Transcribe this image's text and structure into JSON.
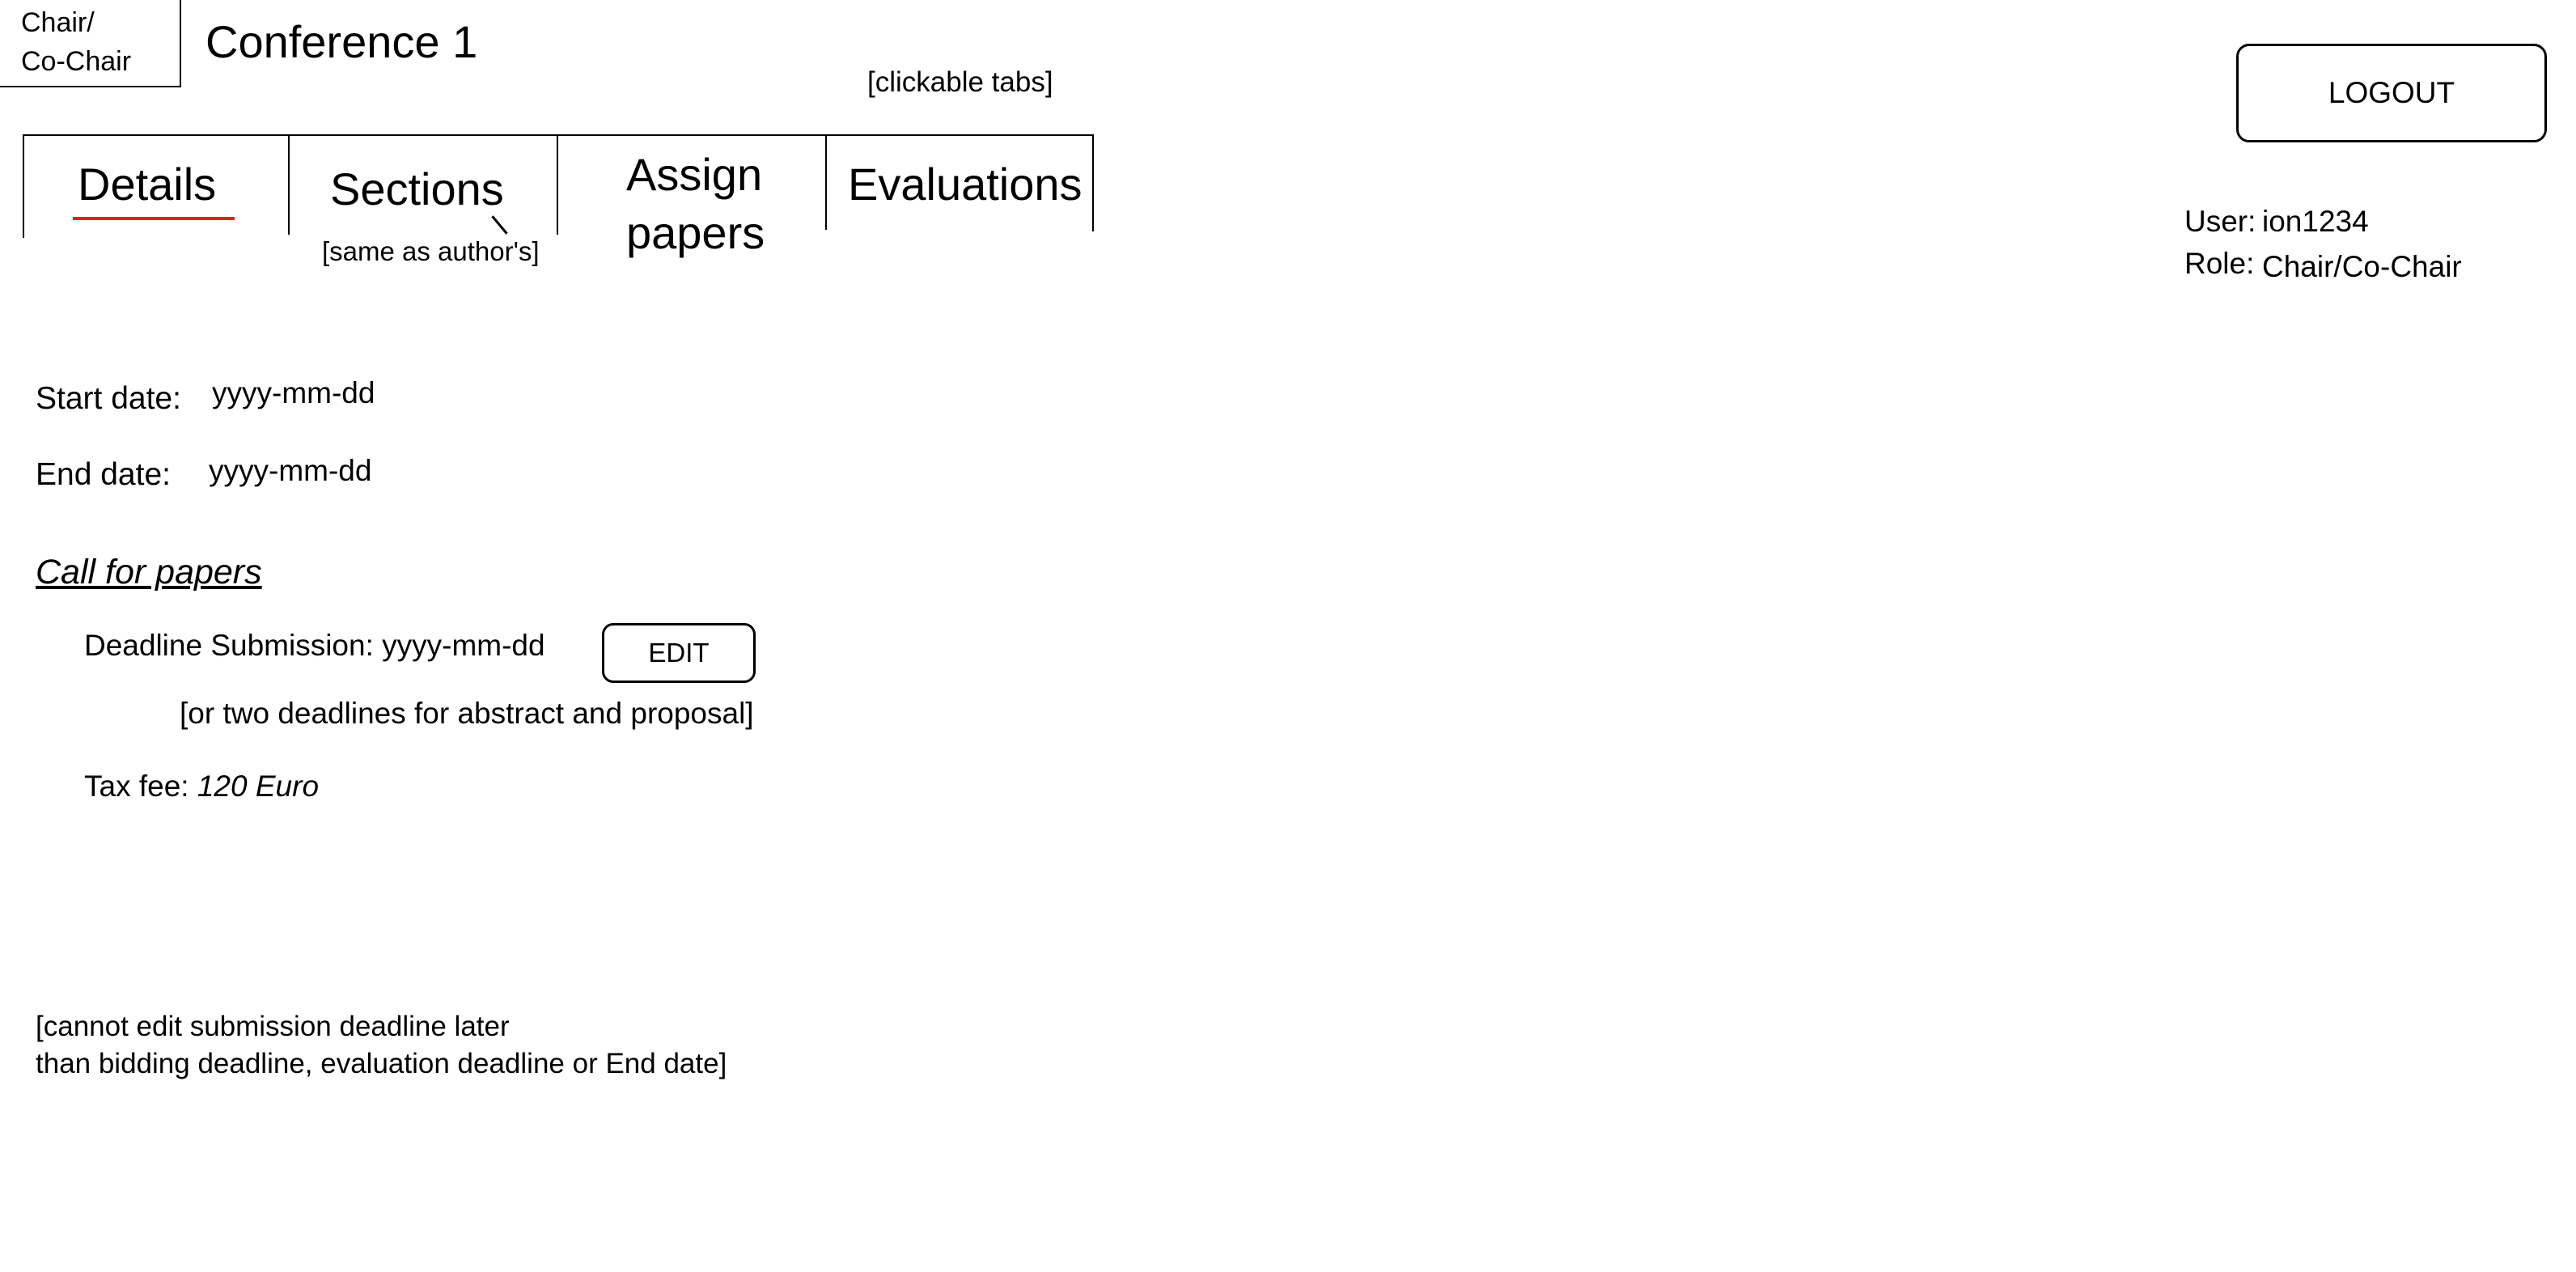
{
  "role_box": {
    "line1": "Chair/",
    "line2": "Co-Chair"
  },
  "conference": {
    "title": "Conference 1"
  },
  "annotations": {
    "tabs_note": "[clickable tabs]",
    "sections_note": "[same as author's]",
    "deadlines_note": "[or two deadlines for abstract and proposal]",
    "bottom_note_line1": "[cannot edit submission deadline later",
    "bottom_note_line2": "than bidding deadline, evaluation deadline or End date]"
  },
  "tabs": [
    {
      "label": "Details",
      "active": true
    },
    {
      "label": "Sections",
      "active": false
    },
    {
      "label_line1": "Assign",
      "label_line2": "papers",
      "active": false
    },
    {
      "label": "Evaluations",
      "active": false
    }
  ],
  "header": {
    "logout_label": "LOGOUT",
    "user_label": "User:",
    "user_value": "ion1234",
    "role_label": "Role:",
    "role_value": "Chair/Co-Chair"
  },
  "details": {
    "start_label": "Start date:",
    "start_value": "yyyy-mm-dd",
    "end_label": "End date:",
    "end_value": "yyyy-mm-dd",
    "cfp_heading": "Call for papers",
    "deadline_label": "Deadline Submission:",
    "deadline_value": "yyyy-mm-dd",
    "edit_label": "EDIT",
    "tax_label": "Tax fee:",
    "tax_value": "120 Euro"
  },
  "colors": {
    "active_tab_underline": "#e02020",
    "border": "#000000",
    "background": "#ffffff"
  }
}
